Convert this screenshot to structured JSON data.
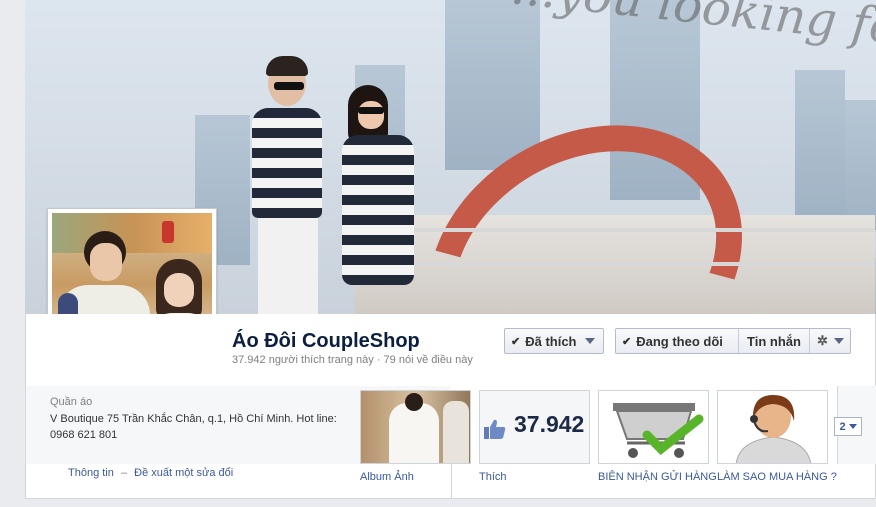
{
  "cover": {
    "script_text": "...you looking for?"
  },
  "page": {
    "name": "Áo Đôi CoupleShop",
    "stats": "37.942 người thích trang này · 79 nói về điều này"
  },
  "actions": {
    "liked_label": "Đã thích",
    "following_label": "Đang theo dõi",
    "message_label": "Tin nhắn",
    "settings_icon": "gear-icon"
  },
  "about": {
    "category": "Quần áo",
    "address": "V Boutique 75 Trần Khắc Chân, q.1, Hồ Chí Minh. Hot line: 0968 621 801",
    "info_link": "Thông tin",
    "dash": "–",
    "suggest_link": "Đề xuất một sửa đổi"
  },
  "apps": {
    "photos_label": "Album Ảnh",
    "likes_count": "37.942",
    "likes_label": "Thích",
    "app1_label": "BIÊN NHẬN GỬI HÀNG",
    "app2_label": "LÀM SAO MUA HÀNG ?",
    "more_count": "2"
  },
  "colors": {
    "link": "#3b5998",
    "name": "#0c1f3f",
    "background": "#e9ebee"
  }
}
